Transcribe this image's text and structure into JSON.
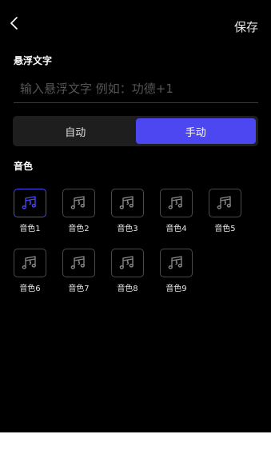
{
  "header": {
    "back_icon": "chevron-left-icon",
    "save_label": "保存"
  },
  "float_text": {
    "label": "悬浮文字",
    "placeholder": "输入悬浮文字 例如：功德+1",
    "value": ""
  },
  "mode": {
    "options": [
      "自动",
      "手动"
    ],
    "selected": "手动"
  },
  "tones": {
    "label": "音色",
    "icon": "music-note-icon",
    "selected": "音色1",
    "accent": "#4c47f0",
    "items": [
      "音色1",
      "音色2",
      "音色3",
      "音色4",
      "音色5",
      "音色6",
      "音色7",
      "音色8",
      "音色9"
    ]
  }
}
